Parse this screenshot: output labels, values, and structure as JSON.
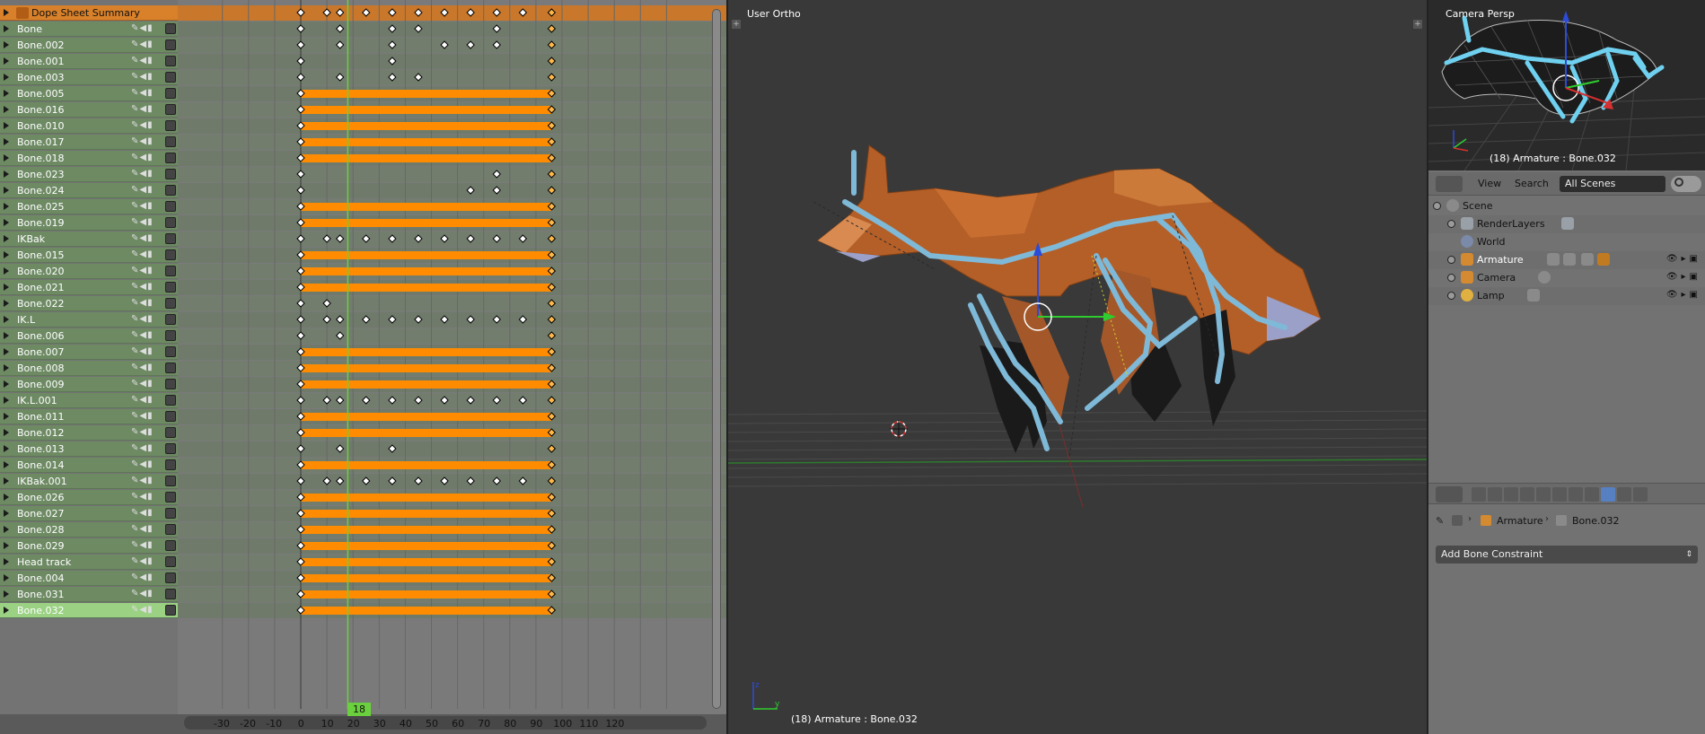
{
  "dopesheet": {
    "summary_label": "Dope Sheet Summary",
    "channel_names": [
      "Bone",
      "Bone.002",
      "Bone.001",
      "Bone.003",
      "Bone.005",
      "Bone.016",
      "Bone.010",
      "Bone.017",
      "Bone.018",
      "Bone.023",
      "Bone.024",
      "Bone.025",
      "Bone.019",
      "IKBak",
      "Bone.015",
      "Bone.020",
      "Bone.021",
      "Bone.022",
      "IK.L",
      "Bone.006",
      "Bone.007",
      "Bone.008",
      "Bone.009",
      "IK.L.001",
      "Bone.011",
      "Bone.012",
      "Bone.013",
      "Bone.014",
      "IKBak.001",
      "Bone.026",
      "Bone.027",
      "Bone.028",
      "Bone.029",
      "Head track",
      "Bone.004",
      "Bone.031",
      "Bone.032"
    ],
    "selected_channel": "Bone.032",
    "ruler_labels": [
      "-30",
      "-20",
      "-10",
      "0",
      "10",
      "20",
      "30",
      "40",
      "50",
      "60",
      "70",
      "80",
      "90",
      "100",
      "110",
      "120"
    ],
    "current_frame": "18",
    "colors": {
      "channel_bg": "#6d8a63",
      "summary_bg": "#d9812a",
      "keyframe_bar": "#ff8c00",
      "playhead": "#6ad03d"
    }
  },
  "viewport": {
    "view_label": "User Ortho",
    "status_label": "(18) Armature : Bone.032"
  },
  "camera_view": {
    "view_label": "Camera Persp",
    "status_label": "(18) Armature : Bone.032"
  },
  "outliner": {
    "view_label": "View",
    "search_label": "Search",
    "scenes_dropdown": "All Scenes",
    "items": [
      {
        "label": "Scene"
      },
      {
        "label": "RenderLayers"
      },
      {
        "label": "World"
      },
      {
        "label": "Armature"
      },
      {
        "label": "Camera"
      },
      {
        "label": "Lamp"
      }
    ]
  },
  "properties": {
    "breadcrumb_object": "Armature",
    "breadcrumb_bone": "Bone.032",
    "add_constraint_label": "Add Bone Constraint"
  }
}
